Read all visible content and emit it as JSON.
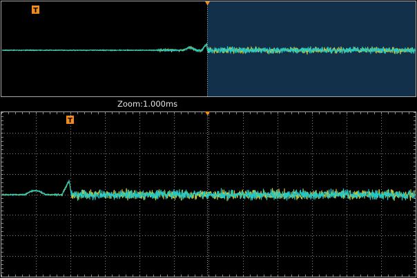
{
  "overview": {
    "trigger_marker": "T",
    "zoom_label": "Zoom:1.000ms"
  },
  "zoom_window": {
    "trigger_marker": "T"
  },
  "colors": {
    "background": "#000000",
    "frame": "#a8a8a8",
    "grid": "#8a8a8a",
    "zoom_region": "#12304a",
    "trigger_marker": "#f28a1e",
    "channel_1_trace": "#c8c83a",
    "channel_2_trace": "#22c8c8",
    "label_text": "#e6e6e6"
  }
}
